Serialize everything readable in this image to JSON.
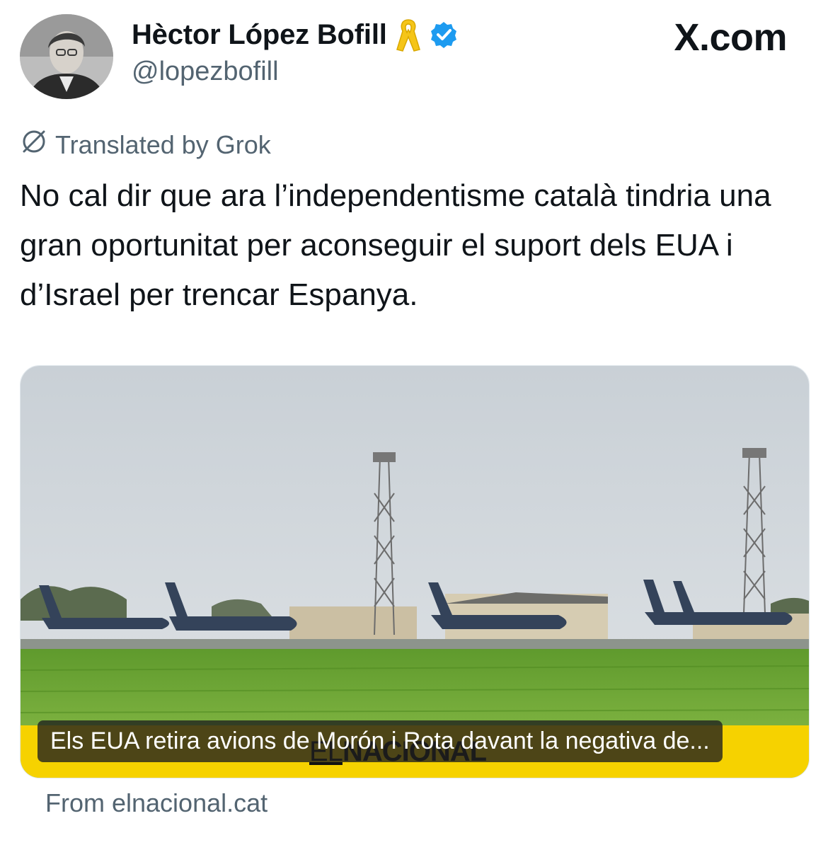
{
  "author": {
    "display_name": "Hèctor López Bofill",
    "handle": "@lopezbofill",
    "verified": true,
    "badge_icons": [
      "yellow-ribbon-icon",
      "verified-badge-icon"
    ]
  },
  "site_label": "X.com",
  "translation_notice": "Translated by Grok",
  "tweet_text": "No cal dir que ara l’independentisme català tindria una gran oportunitat per aconseguir el suport dels EUA i d’Israel per trencar Espanya.",
  "card": {
    "headline": "Els EUA retira avions de Morón i Rota davant la negativa de...",
    "watermark": {
      "prefix": "EL",
      "name": "NACIONAL"
    },
    "source": "From elnacional.cat"
  },
  "colors": {
    "text_primary": "#0f1419",
    "text_secondary": "#536471",
    "verified_blue": "#1d9bf0",
    "ribbon_yellow": "#f5c518",
    "card_band_yellow": "#f6d200"
  }
}
